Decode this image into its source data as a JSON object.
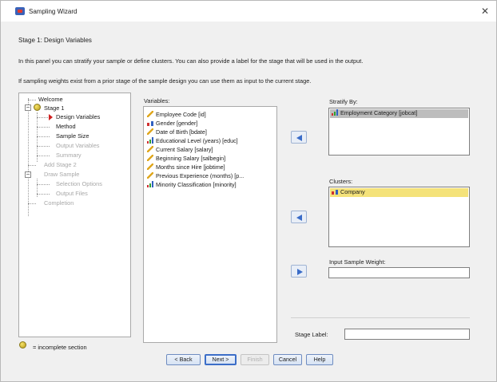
{
  "window": {
    "title": "Sampling Wizard",
    "close_glyph": "✕"
  },
  "stage_heading": "Stage 1: Design Variables",
  "info": {
    "line1": "In this panel you can stratify your sample or define clusters. You can also provide a label for the stage that will be used in the output.",
    "line2": "If sampling weights exist from a prior stage of the sample design you can use them as input to the current stage."
  },
  "tree": {
    "items": [
      {
        "label": "Welcome",
        "enabled": true
      },
      {
        "label": "Stage 1",
        "enabled": true
      },
      {
        "label": "Design Variables",
        "enabled": true,
        "current": true
      },
      {
        "label": "Method",
        "enabled": true
      },
      {
        "label": "Sample Size",
        "enabled": true
      },
      {
        "label": "Output Variables",
        "enabled": false
      },
      {
        "label": "Summary",
        "enabled": false
      },
      {
        "label": "Add Stage 2",
        "enabled": false
      },
      {
        "label": "Draw Sample",
        "enabled": false
      },
      {
        "label": "Selection Options",
        "enabled": false
      },
      {
        "label": "Output Files",
        "enabled": false
      },
      {
        "label": "Completion",
        "enabled": false
      }
    ],
    "legend": "= incomplete section"
  },
  "variables": {
    "label": "Variables:",
    "items": [
      {
        "label": "Employee Code [id]",
        "icon": "scale-icon"
      },
      {
        "label": "Gender [gender]",
        "icon": "nominal-icon"
      },
      {
        "label": "Date of Birth [bdate]",
        "icon": "date-icon"
      },
      {
        "label": "Educational Level (years) [educ]",
        "icon": "ordinal-icon"
      },
      {
        "label": "Current Salary [salary]",
        "icon": "scale-icon"
      },
      {
        "label": "Beginning Salary [salbegin]",
        "icon": "scale-icon"
      },
      {
        "label": "Months since Hire [jobtime]",
        "icon": "scale-icon"
      },
      {
        "label": "Previous Experience (months) [p...",
        "icon": "scale-icon"
      },
      {
        "label": "Minority Classification [minority]",
        "icon": "ordinal-icon"
      }
    ]
  },
  "stratify": {
    "label": "Stratify By:",
    "items": [
      "Employment Category [jobcat]"
    ]
  },
  "clusters": {
    "label": "Clusters:",
    "items": [
      "Company"
    ]
  },
  "weight": {
    "label": "Input Sample Weight:",
    "value": ""
  },
  "stage_label": {
    "label": "Stage Label:",
    "value": ""
  },
  "buttons": {
    "back": "< Back",
    "next": "Next >",
    "finish": "Finish",
    "cancel": "Cancel",
    "help": "Help"
  }
}
